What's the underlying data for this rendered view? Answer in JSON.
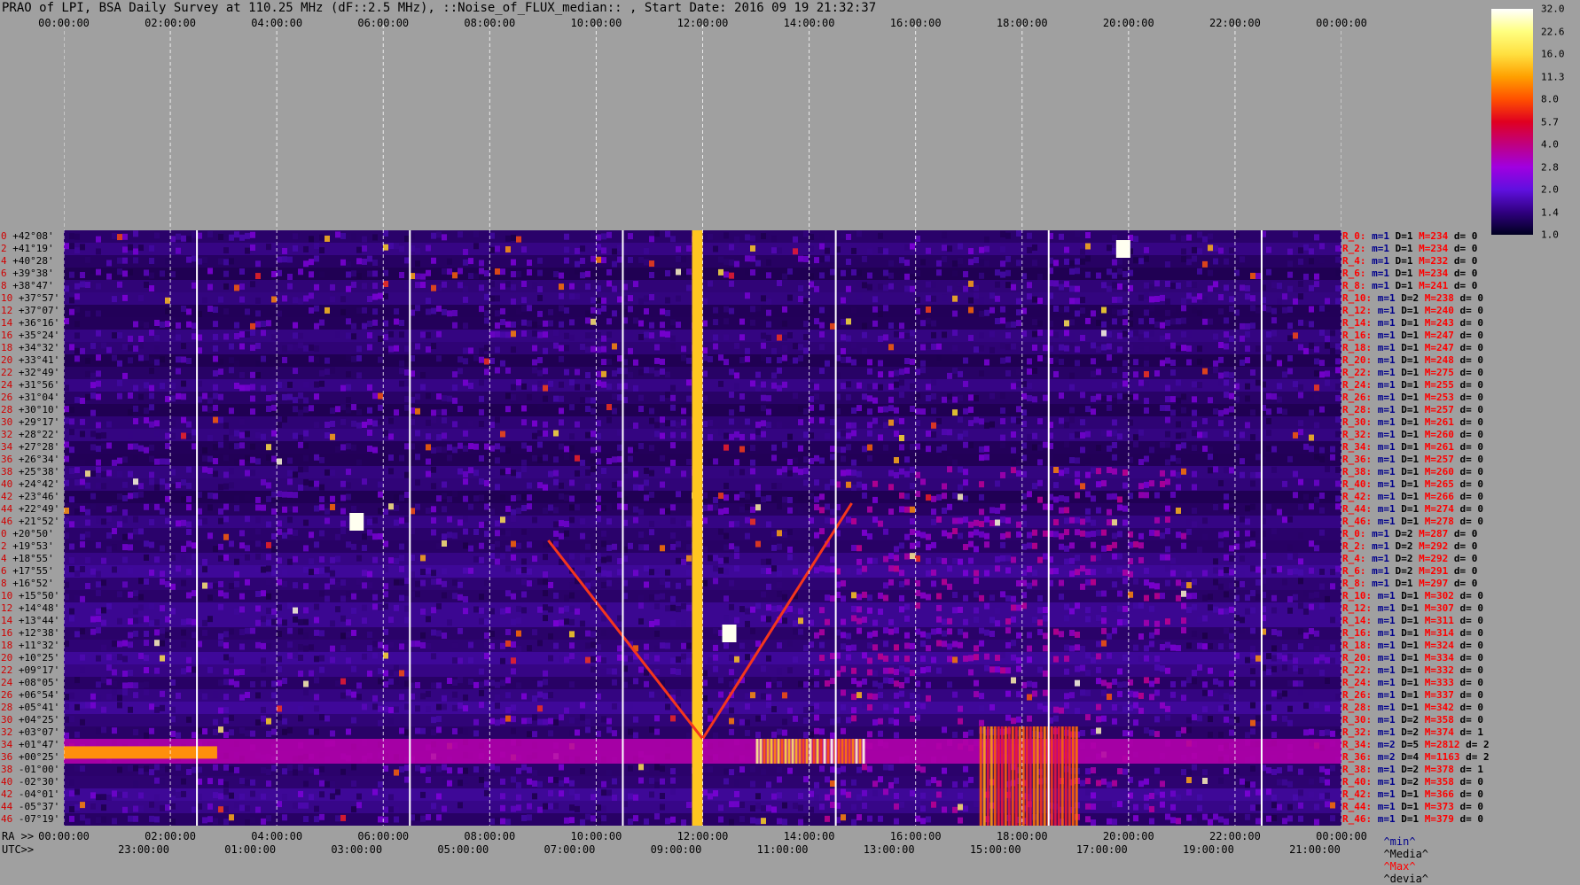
{
  "header": {
    "title": "PRAO of LPI, BSA Daily Survey at 110.25 MHz (dF::2.5 MHz), ::Noise_of_FLUX_median:: , Start Date: 2016 09 19 21:32:37"
  },
  "top_axis_labels": [
    "00:00:00",
    "02:00:00",
    "04:00:00",
    "06:00:00",
    "08:00:00",
    "10:00:00",
    "12:00:00",
    "14:00:00",
    "16:00:00",
    "18:00:00",
    "20:00:00",
    "22:00:00",
    "00:00:00"
  ],
  "ra_axis": {
    "prefix": "RA >>",
    "labels": [
      "00:00:00",
      "02:00:00",
      "04:00:00",
      "06:00:00",
      "08:00:00",
      "10:00:00",
      "12:00:00",
      "14:00:00",
      "16:00:00",
      "18:00:00",
      "20:00:00",
      "22:00:00",
      "00:00:00"
    ]
  },
  "utc_axis": {
    "prefix": "UTC>>",
    "labels": [
      "23:00:00",
      "01:00:00",
      "03:00:00",
      "05:00:00",
      "07:00:00",
      "09:00:00",
      "11:00:00",
      "13:00:00",
      "15:00:00",
      "17:00:00",
      "19:00:00",
      "21:00:00"
    ]
  },
  "colorbar": {
    "ticks": [
      "32.0",
      "22.6",
      "16.0",
      "11.3",
      "8.0",
      "5.7",
      "4.0",
      "2.8",
      "2.0",
      "1.4",
      "1.0"
    ],
    "colors": [
      "#ffffff",
      "#ffff80",
      "#ffe040",
      "#ffa000",
      "#ff5000",
      "#e00020",
      "#c00080",
      "#a000e0",
      "#6010e0",
      "#300080",
      "#000020"
    ]
  },
  "legend": {
    "min": "^min^",
    "median": "^Media^",
    "max": "^Max^",
    "dev": "^devia^",
    "colors": {
      "min": "#00008c",
      "median": "#000000",
      "max": "#ff0000",
      "dev": "#000000"
    }
  },
  "declinations": [
    "+42°08'",
    "+41°19'",
    "+40°28'",
    "+39°38'",
    "+38°47'",
    "+37°57'",
    "+37°07'",
    "+36°16'",
    "+35°24'",
    "+34°32'",
    "+33°41'",
    "+32°49'",
    "+31°56'",
    "+31°04'",
    "+30°10'",
    "+29°17'",
    "+28°22'",
    "+27°28'",
    "+26°34'",
    "+25°38'",
    "+24°42'",
    "+23°46'",
    "+22°49'",
    "+21°52'",
    "+20°50'",
    "+19°53'",
    "+18°55'",
    "+17°55'",
    "+16°52'",
    "+15°50'",
    "+14°48'",
    "+13°44'",
    "+12°38'",
    "+11°32'",
    "+10°25'",
    "+09°17'",
    "+08°05'",
    "+06°54'",
    "+05°41'",
    "+04°25'",
    "+03°07'",
    "+01°47'",
    "+00°25'",
    "-01°00'",
    "-02°30'",
    "-04°01'",
    "-05°37'",
    "-07°19'"
  ],
  "row_indices": [
    "0",
    "2",
    "4",
    "6",
    "8",
    "10",
    "12",
    "14",
    "16",
    "18",
    "20",
    "22",
    "24",
    "26",
    "28",
    "30",
    "32",
    "34",
    "36",
    "38",
    "40",
    "42",
    "44",
    "46",
    "0",
    "2",
    "4",
    "6",
    "8",
    "10",
    "12",
    "14",
    "16",
    "18",
    "20",
    "22",
    "24",
    "26",
    "28",
    "30",
    "32",
    "34",
    "36",
    "38",
    "40",
    "42",
    "44",
    "46"
  ],
  "row_stats": [
    {
      "name": "R_0:",
      "min": "m=1",
      "dev": "D=1",
      "max": "M=234",
      "d": "d= 0"
    },
    {
      "name": "R_2:",
      "min": "m=1",
      "dev": "D=1",
      "max": "M=234",
      "d": "d= 0"
    },
    {
      "name": "R_4:",
      "min": "m=1",
      "dev": "D=1",
      "max": "M=232",
      "d": "d= 0"
    },
    {
      "name": "R_6:",
      "min": "m=1",
      "dev": "D=1",
      "max": "M=234",
      "d": "d= 0"
    },
    {
      "name": "R_8:",
      "min": "m=1",
      "dev": "D=1",
      "max": "M=241",
      "d": "d= 0"
    },
    {
      "name": "R_10:",
      "min": "m=1",
      "dev": "D=2",
      "max": "M=238",
      "d": "d= 0"
    },
    {
      "name": "R_12:",
      "min": "m=1",
      "dev": "D=1",
      "max": "M=240",
      "d": "d= 0"
    },
    {
      "name": "R_14:",
      "min": "m=1",
      "dev": "D=1",
      "max": "M=243",
      "d": "d= 0"
    },
    {
      "name": "R_16:",
      "min": "m=1",
      "dev": "D=1",
      "max": "M=247",
      "d": "d= 0"
    },
    {
      "name": "R_18:",
      "min": "m=1",
      "dev": "D=1",
      "max": "M=247",
      "d": "d= 0"
    },
    {
      "name": "R_20:",
      "min": "m=1",
      "dev": "D=1",
      "max": "M=248",
      "d": "d= 0"
    },
    {
      "name": "R_22:",
      "min": "m=1",
      "dev": "D=1",
      "max": "M=275",
      "d": "d= 0"
    },
    {
      "name": "R_24:",
      "min": "m=1",
      "dev": "D=1",
      "max": "M=255",
      "d": "d= 0"
    },
    {
      "name": "R_26:",
      "min": "m=1",
      "dev": "D=1",
      "max": "M=253",
      "d": "d= 0"
    },
    {
      "name": "R_28:",
      "min": "m=1",
      "dev": "D=1",
      "max": "M=257",
      "d": "d= 0"
    },
    {
      "name": "R_30:",
      "min": "m=1",
      "dev": "D=1",
      "max": "M=261",
      "d": "d= 0"
    },
    {
      "name": "R_32:",
      "min": "m=1",
      "dev": "D=1",
      "max": "M=260",
      "d": "d= 0"
    },
    {
      "name": "R_34:",
      "min": "m=1",
      "dev": "D=1",
      "max": "M=261",
      "d": "d= 0"
    },
    {
      "name": "R_36:",
      "min": "m=1",
      "dev": "D=1",
      "max": "M=257",
      "d": "d= 0"
    },
    {
      "name": "R_38:",
      "min": "m=1",
      "dev": "D=1",
      "max": "M=260",
      "d": "d= 0"
    },
    {
      "name": "R_40:",
      "min": "m=1",
      "dev": "D=1",
      "max": "M=265",
      "d": "d= 0"
    },
    {
      "name": "R_42:",
      "min": "m=1",
      "dev": "D=1",
      "max": "M=266",
      "d": "d= 0"
    },
    {
      "name": "R_44:",
      "min": "m=1",
      "dev": "D=1",
      "max": "M=274",
      "d": "d= 0"
    },
    {
      "name": "R_46:",
      "min": "m=1",
      "dev": "D=1",
      "max": "M=278",
      "d": "d= 0"
    },
    {
      "name": "R_0:",
      "min": "m=1",
      "dev": "D=2",
      "max": "M=287",
      "d": "d= 0"
    },
    {
      "name": "R_2:",
      "min": "m=1",
      "dev": "D=2",
      "max": "M=292",
      "d": "d= 0"
    },
    {
      "name": "R_4:",
      "min": "m=1",
      "dev": "D=2",
      "max": "M=292",
      "d": "d= 0"
    },
    {
      "name": "R_6:",
      "min": "m=1",
      "dev": "D=2",
      "max": "M=291",
      "d": "d= 0"
    },
    {
      "name": "R_8:",
      "min": "m=1",
      "dev": "D=1",
      "max": "M=297",
      "d": "d= 0"
    },
    {
      "name": "R_10:",
      "min": "m=1",
      "dev": "D=1",
      "max": "M=302",
      "d": "d= 0"
    },
    {
      "name": "R_12:",
      "min": "m=1",
      "dev": "D=1",
      "max": "M=307",
      "d": "d= 0"
    },
    {
      "name": "R_14:",
      "min": "m=1",
      "dev": "D=1",
      "max": "M=311",
      "d": "d= 0"
    },
    {
      "name": "R_16:",
      "min": "m=1",
      "dev": "D=1",
      "max": "M=314",
      "d": "d= 0"
    },
    {
      "name": "R_18:",
      "min": "m=1",
      "dev": "D=1",
      "max": "M=324",
      "d": "d= 0"
    },
    {
      "name": "R_20:",
      "min": "m=1",
      "dev": "D=1",
      "max": "M=334",
      "d": "d= 0"
    },
    {
      "name": "R_22:",
      "min": "m=1",
      "dev": "D=1",
      "max": "M=332",
      "d": "d= 0"
    },
    {
      "name": "R_24:",
      "min": "m=1",
      "dev": "D=1",
      "max": "M=333",
      "d": "d= 0"
    },
    {
      "name": "R_26:",
      "min": "m=1",
      "dev": "D=1",
      "max": "M=337",
      "d": "d= 0"
    },
    {
      "name": "R_28:",
      "min": "m=1",
      "dev": "D=1",
      "max": "M=342",
      "d": "d= 0"
    },
    {
      "name": "R_30:",
      "min": "m=1",
      "dev": "D=2",
      "max": "M=358",
      "d": "d= 0"
    },
    {
      "name": "R_32:",
      "min": "m=1",
      "dev": "D=2",
      "max": "M=374",
      "d": "d= 1"
    },
    {
      "name": "R_34:",
      "min": "m=2",
      "dev": "D=5",
      "max": "M=2812",
      "d": "d= 2"
    },
    {
      "name": "R_36:",
      "min": "m=2",
      "dev": "D=4",
      "max": "M=1163",
      "d": "d= 2"
    },
    {
      "name": "R_38:",
      "min": "m=1",
      "dev": "D=2",
      "max": "M=378",
      "d": "d= 1"
    },
    {
      "name": "R_40:",
      "min": "m=1",
      "dev": "D=2",
      "max": "M=358",
      "d": "d= 0"
    },
    {
      "name": "R_42:",
      "min": "m=1",
      "dev": "D=1",
      "max": "M=366",
      "d": "d= 0"
    },
    {
      "name": "R_44:",
      "min": "m=1",
      "dev": "D=1",
      "max": "M=373",
      "d": "d= 0"
    },
    {
      "name": "R_46:",
      "min": "m=1",
      "dev": "D=1",
      "max": "M=379",
      "d": "d= 0"
    }
  ],
  "chart_data": {
    "type": "heatmap",
    "x_axis": "RA 00:00:00 to 24:00:00 (hours)",
    "y_axis": "Declination rows",
    "value_range": [
      1.0,
      32.0
    ],
    "color_scale": "log",
    "grid": true,
    "features": [
      {
        "kind": "horizontal_band",
        "rows": [
          "+01°47'",
          "+00°25'"
        ],
        "ra_hours": [
          0,
          24
        ],
        "intensity": "high"
      },
      {
        "kind": "bright_region",
        "ra_hours": [
          13.0,
          15.0
        ],
        "rows": [
          "+01°47'",
          "+00°25'"
        ],
        "intensity": 32
      },
      {
        "kind": "bright_region",
        "ra_hours": [
          17.2,
          19.0
        ],
        "rows": [
          "+03°07'",
          "-07°19'"
        ],
        "intensity": 22
      },
      {
        "kind": "vertical_source",
        "ra_hours": [
          11.8,
          12.0
        ],
        "rows": [
          "+42°08'",
          "-07°19'"
        ],
        "intensity": 32
      },
      {
        "kind": "point_source",
        "ra_hours": 19.9,
        "row": "+41°19'",
        "intensity": 32
      },
      {
        "kind": "diagonal_track",
        "ra_hours": [
          9.1,
          12.0
        ],
        "rows": [
          "+19°53'",
          "+01°47'"
        ],
        "intensity": 8
      },
      {
        "kind": "diagonal_track",
        "ra_hours": [
          12.0,
          14.8
        ],
        "rows": [
          "+01°47'",
          "+22°49'"
        ],
        "intensity": 8
      },
      {
        "kind": "point_source",
        "ra_hours": 5.5,
        "row": "+21°52'",
        "intensity": 22
      },
      {
        "kind": "point_source",
        "ra_hours": 12.5,
        "row": "+12°38'",
        "intensity": 22
      }
    ]
  }
}
